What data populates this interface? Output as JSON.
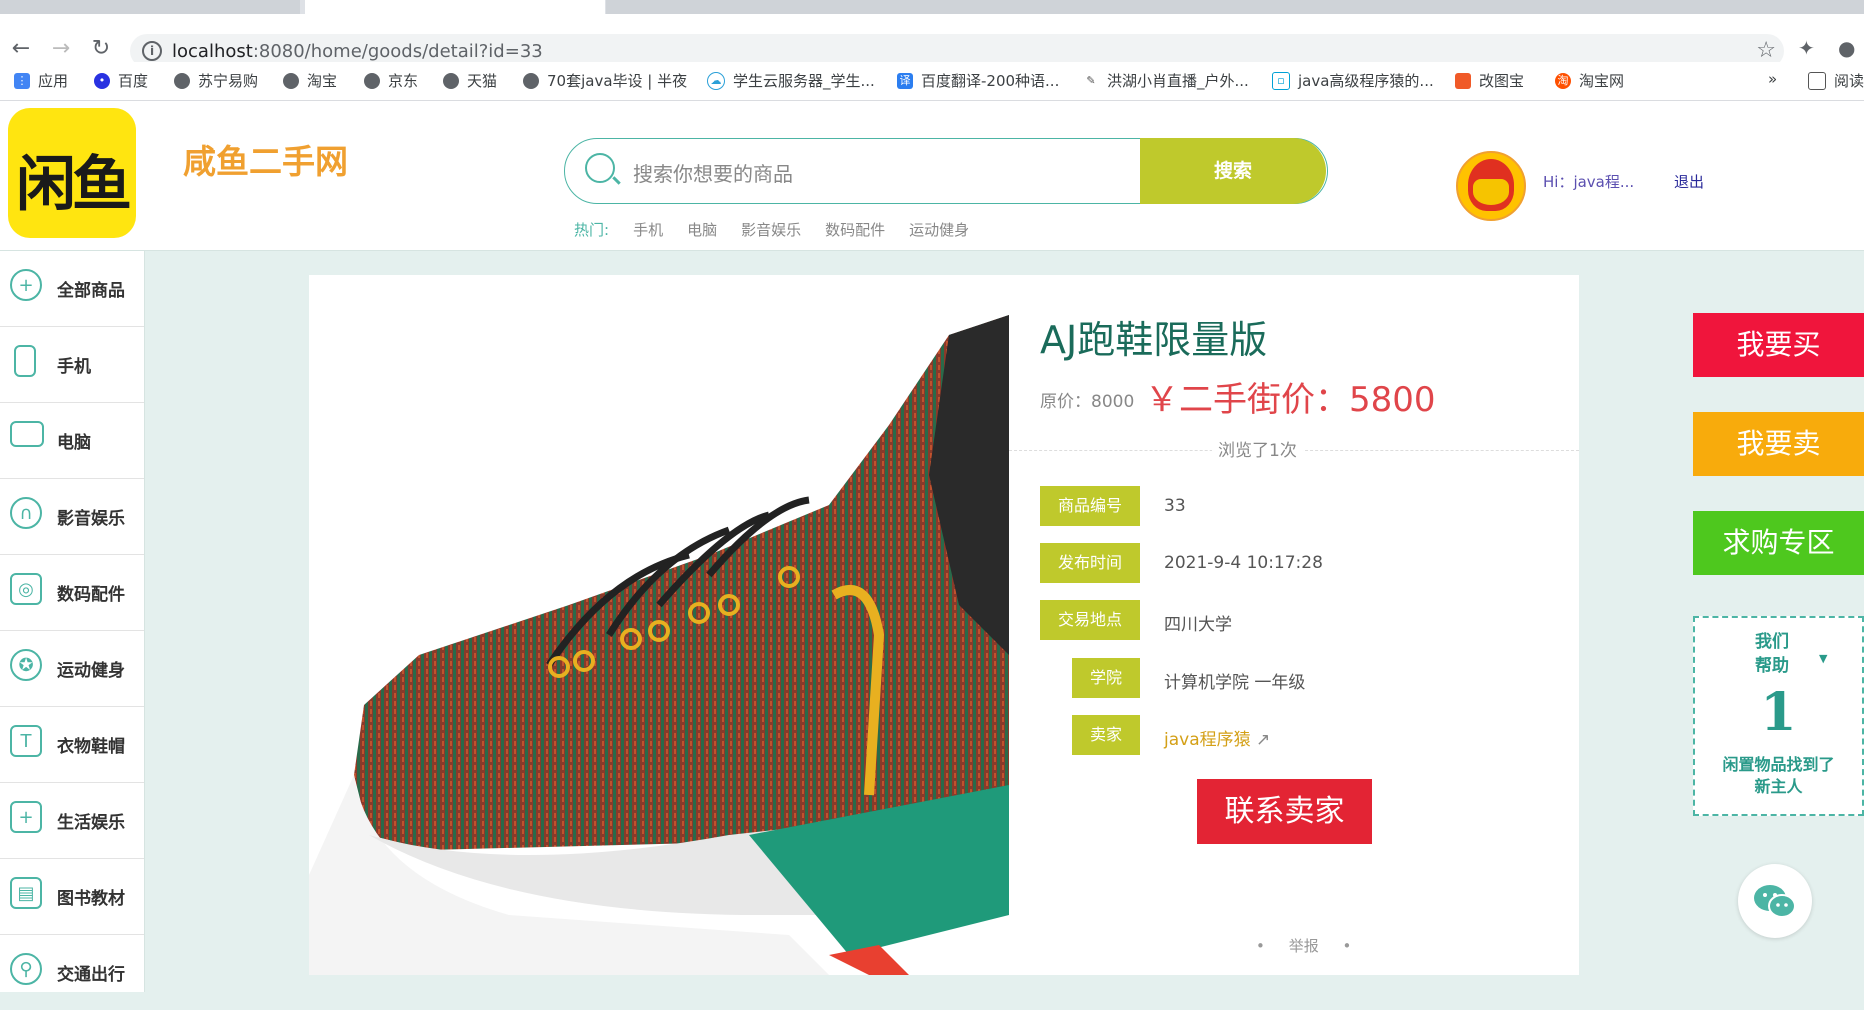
{
  "browser": {
    "url_host": "localhost",
    "url_rest": ":8080/home/goods/detail?id=33",
    "bookmarks": [
      {
        "label": "应用",
        "icon": "apps-grid-icon"
      },
      {
        "label": "百度",
        "icon": "baidu-paw-icon"
      },
      {
        "label": "苏宁易购",
        "icon": "globe-icon"
      },
      {
        "label": "淘宝",
        "icon": "globe-icon"
      },
      {
        "label": "京东",
        "icon": "globe-icon"
      },
      {
        "label": "天猫",
        "icon": "globe-icon"
      },
      {
        "label": "70套java毕设 | 半夜",
        "icon": "globe-icon"
      },
      {
        "label": "学生云服务器_学生...",
        "icon": "cloud-icon"
      },
      {
        "label": "百度翻译-200种语...",
        "icon": "translate-icon"
      },
      {
        "label": "洪湖小肖直播_户外...",
        "icon": "pen-icon"
      },
      {
        "label": "java高级程序猿的...",
        "icon": "bilibili-icon"
      },
      {
        "label": "改图宝",
        "icon": "image-icon"
      },
      {
        "label": "淘宝网",
        "icon": "taobao-icon"
      }
    ],
    "overflow": "»",
    "reading_list": "阅读"
  },
  "header": {
    "logo_text": "闲鱼",
    "site_name": "咸鱼二手网",
    "search_placeholder": "搜索你想要的商品",
    "search_button": "搜索",
    "hot_label": "热门:",
    "hot_links": [
      "手机",
      "电脑",
      "影音娱乐",
      "数码配件",
      "运动健身"
    ],
    "greeting": "Hi：java程...",
    "logout": "退出"
  },
  "sidebar": {
    "items": [
      {
        "label": "全部商品",
        "icon": "plus-circle-icon"
      },
      {
        "label": "手机",
        "icon": "phone-icon"
      },
      {
        "label": "电脑",
        "icon": "monitor-icon"
      },
      {
        "label": "影音娱乐",
        "icon": "headphones-icon"
      },
      {
        "label": "数码配件",
        "icon": "camera-icon"
      },
      {
        "label": "运动健身",
        "icon": "soccer-ball-icon"
      },
      {
        "label": "衣物鞋帽",
        "icon": "shirt-icon"
      },
      {
        "label": "生活娱乐",
        "icon": "gamepad-icon"
      },
      {
        "label": "图书教材",
        "icon": "book-icon"
      },
      {
        "label": "交通出行",
        "icon": "scooter-icon"
      }
    ]
  },
  "product": {
    "title": "AJ跑鞋限量版",
    "original_price_label": "原价：8000",
    "price_label": "￥二手街价：5800",
    "views": "浏览了1次",
    "fields": [
      {
        "tag": "商品编号",
        "value": "33"
      },
      {
        "tag": "发布时间",
        "value": "2021-9-4 10:17:28"
      },
      {
        "tag": "交易地点",
        "value": "四川大学"
      },
      {
        "tag": "学院",
        "value": "计算机学院 一年级"
      },
      {
        "tag": "卖家",
        "value": "java程序猿"
      }
    ],
    "contact_button": "联系卖家",
    "report": "举报"
  },
  "side_panel": {
    "buy": "我要买",
    "sell": "我要卖",
    "wanted": "求购专区",
    "helped_line1": "我们",
    "helped_line2": "帮助",
    "helped_count": "1",
    "helped_line3": "闲置物品找到了",
    "helped_line4": "新主人"
  },
  "colors": {
    "brand_green": "#4cb5a5",
    "olive": "#bfc92c",
    "price_red": "#e0454a",
    "buy_red": "#f0153c",
    "sell_orange": "#f8ab0c",
    "wanted_green": "#4ec81e",
    "contact_red": "#e32434"
  }
}
